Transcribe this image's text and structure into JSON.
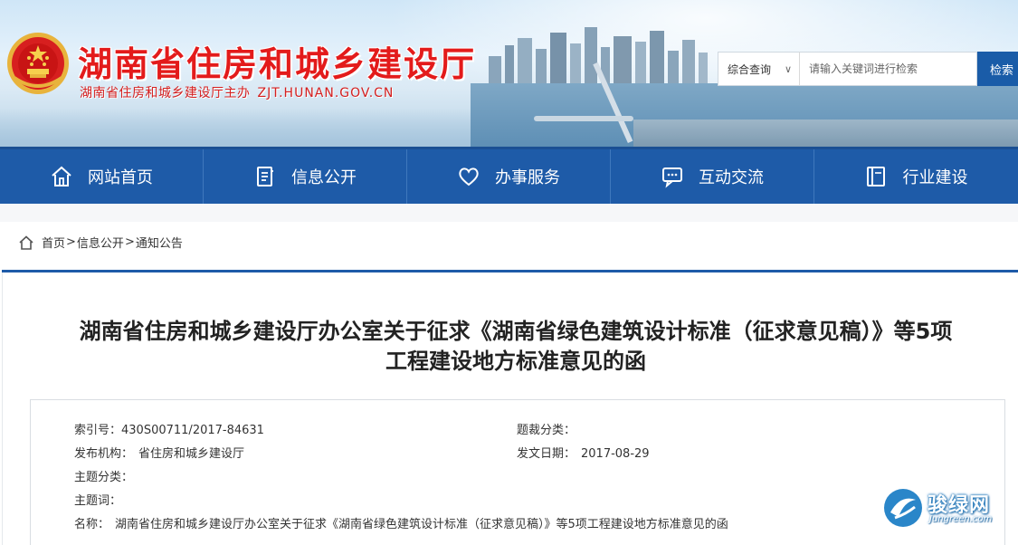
{
  "header": {
    "site_title": "湖南省住房和城乡建设厅",
    "site_subtitle": "湖南省住房和城乡建设厅主办",
    "site_url": "ZJT.HUNAN.GOV.CN",
    "emblem_icon": "national-emblem-icon",
    "search": {
      "scope_label": "综合查询",
      "scope_caret": "∨",
      "placeholder": "请输入关键词进行检索",
      "button_label": "检索"
    }
  },
  "nav": {
    "items": [
      {
        "label": "网站首页",
        "icon": "home-icon"
      },
      {
        "label": "信息公开",
        "icon": "document-icon"
      },
      {
        "label": "办事服务",
        "icon": "heart-icon"
      },
      {
        "label": "互动交流",
        "icon": "chat-icon"
      },
      {
        "label": "行业建设",
        "icon": "book-icon"
      }
    ]
  },
  "breadcrumb": {
    "items": [
      "首页",
      "信息公开",
      "通知公告"
    ],
    "separator": ">"
  },
  "article": {
    "title_line1": "湖南省住房和城乡建设厅办公室关于征求《湖南省绿色建筑设计标准（征求意见稿）》等5项",
    "title_line2": "工程建设地方标准意见的函"
  },
  "meta": {
    "index_label": "索引号：",
    "index_value": "430S00711/2017-84631",
    "category_label": "题裁分类：",
    "category_value": "",
    "publisher_label": "发布机构：",
    "publisher_value": "省住房和城乡建设厅",
    "date_label": "发文日期：",
    "date_value": "2017-08-29",
    "topic_label": "主题分类：",
    "topic_value": "",
    "keywords_label": "主题词：",
    "keywords_value": "",
    "name_label": "名称：",
    "name_value": "湖南省住房和城乡建设厅办公室关于征求《湖南省绿色建筑设计标准（征求意见稿）》等5项工程建设地方标准意见的函"
  },
  "watermark": {
    "text": "骏绿网",
    "url": "Jungreen.com"
  },
  "colors": {
    "nav_bg": "#1e5ba8",
    "title_red": "#e31b1b",
    "search_button": "#1a5ca8"
  }
}
